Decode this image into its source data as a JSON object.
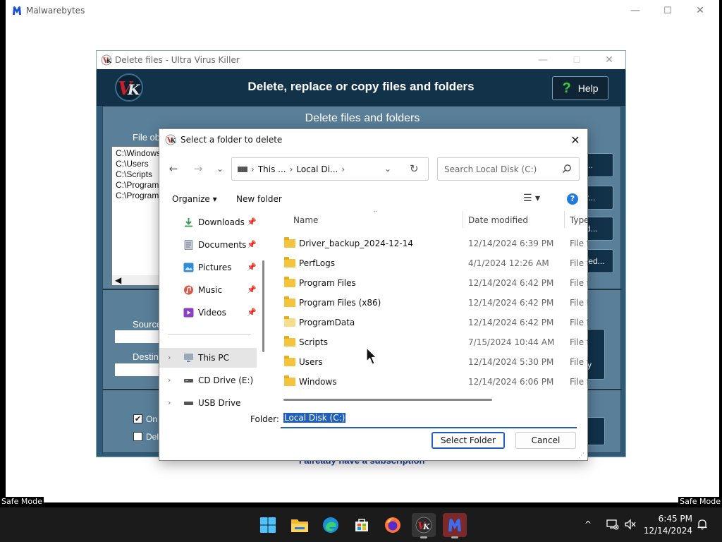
{
  "malwarebytes": {
    "title": "Malwarebytes",
    "minimize": "—",
    "maximize": "☐",
    "close": "✕"
  },
  "safe_mode": {
    "left": "Safe Mode",
    "right": "Safe Mode"
  },
  "uvk": {
    "window_title": "Delete files - Ultra Virus Killer",
    "heading": "Delete, replace or copy files and folders",
    "help_label": "Help",
    "help_icon": "?",
    "subheading": "Delete files and folders",
    "file_objects_label": "File ob",
    "list_items": [
      "C:\\Windows",
      "C:\\Users",
      "C:\\Scripts",
      "C:\\Program",
      "C:\\Program"
    ],
    "side_buttons": [
      "...",
      "r...",
      "d...",
      "fed..."
    ],
    "source_label": "Source",
    "destination_label": "Destin",
    "big_button_label": "y",
    "checkbox1_label": "On",
    "checkbox1_checked": true,
    "checkbox2_label": "Del",
    "subscription_link": "I already have a subscription"
  },
  "dialog": {
    "title": "Select a folder to delete",
    "close": "✕",
    "nav": {
      "back": "←",
      "forward": "→",
      "recent": "⌄",
      "up": ""
    },
    "breadcrumbs": [
      "This ...",
      "Local Di..."
    ],
    "address_dropdown": "⌄",
    "refresh": "↻",
    "search_placeholder": "Search Local Disk (C:)",
    "organize_label": "Organize ▾",
    "new_folder_label": "New folder",
    "view_label": "☰ ▾",
    "help_label": "?",
    "nav_items": [
      {
        "label": "Downloads",
        "icon": "download-icon",
        "color": "#2b9a4a",
        "pinned": true
      },
      {
        "label": "Documents",
        "icon": "documents-icon",
        "color": "#8c97a6",
        "pinned": true
      },
      {
        "label": "Pictures",
        "icon": "pictures-icon",
        "color": "#2f8bd6",
        "pinned": true
      },
      {
        "label": "Music",
        "icon": "music-icon",
        "color": "#d9584a",
        "pinned": true
      },
      {
        "label": "Videos",
        "icon": "videos-icon",
        "color": "#8a3fc4",
        "pinned": true
      },
      {
        "label": "This PC",
        "icon": "computer-icon",
        "color": "#6d8aa3",
        "pinned": false,
        "selected": true
      },
      {
        "label": "CD Drive (E:)",
        "icon": "cd-drive-icon",
        "color": "#555555",
        "pinned": false
      },
      {
        "label": "USB Drive (D:)",
        "icon": "usb-drive-icon",
        "color": "#555555",
        "pinned": false
      }
    ],
    "columns": {
      "name": "Name",
      "date": "Date modified",
      "type": "Type"
    },
    "files": [
      {
        "name": "Driver_backup_2024-12-14",
        "date": "12/14/2024 6:39 PM",
        "type": "File fo"
      },
      {
        "name": "PerfLogs",
        "date": "4/1/2024 12:26 AM",
        "type": "File fo"
      },
      {
        "name": "Program Files",
        "date": "12/14/2024 6:42 PM",
        "type": "File fo"
      },
      {
        "name": "Program Files (x86)",
        "date": "12/14/2024 6:42 PM",
        "type": "File fo"
      },
      {
        "name": "ProgramData",
        "date": "12/14/2024 6:42 PM",
        "type": "File fo",
        "hidden": true
      },
      {
        "name": "Scripts",
        "date": "7/15/2024 10:44 AM",
        "type": "File fo"
      },
      {
        "name": "Users",
        "date": "12/14/2024 5:30 PM",
        "type": "File fo"
      },
      {
        "name": "Windows",
        "date": "12/14/2024 6:06 PM",
        "type": "File fo"
      }
    ],
    "folder_label": "Folder:",
    "folder_value": "Local Disk (C:)",
    "select_folder_label": "Select Folder",
    "cancel_label": "Cancel"
  },
  "taskbar": {
    "apps": [
      "start-icon",
      "file-explorer-icon",
      "edge-icon",
      "store-icon",
      "firefox-icon",
      "uvk-icon",
      "malwarebytes-icon"
    ],
    "tray_overflow": "^",
    "time": "6:45 PM",
    "date": "12/14/2024"
  }
}
